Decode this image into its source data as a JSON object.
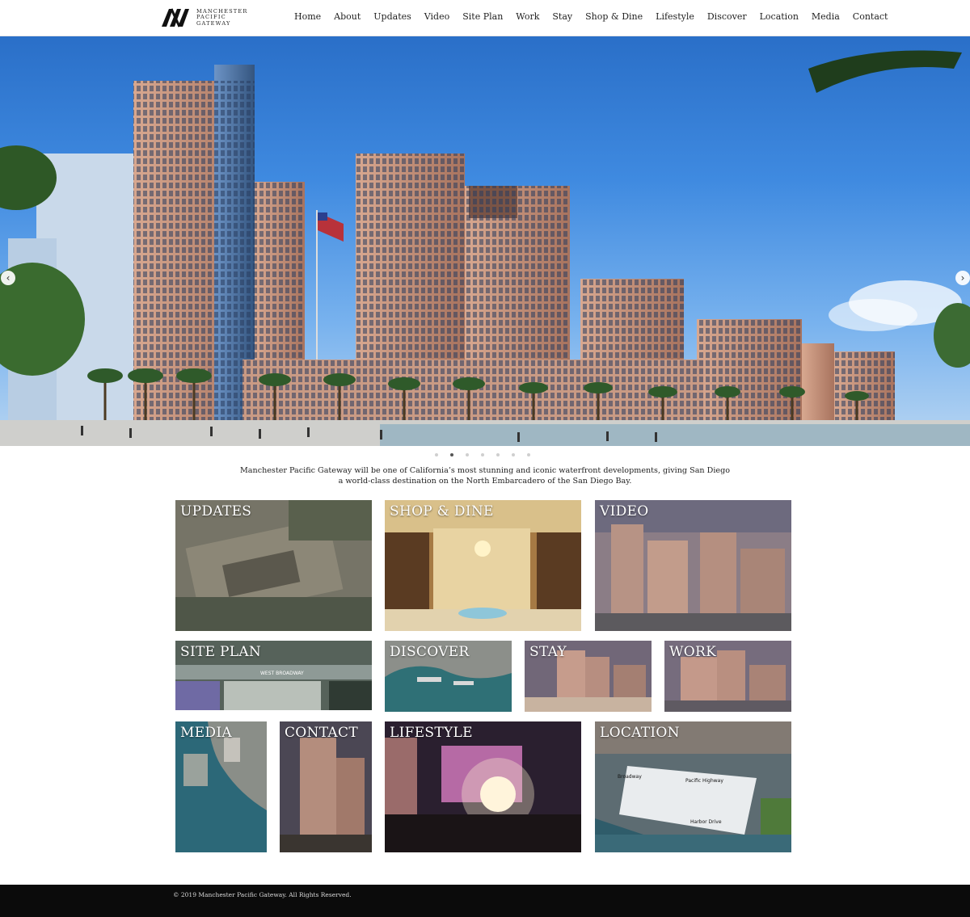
{
  "site": {
    "logo_lines": [
      "Manchester",
      "Pacific",
      "Gateway"
    ]
  },
  "nav": [
    "Home",
    "About",
    "Updates",
    "Video",
    "Site Plan",
    "Work",
    "Stay",
    "Shop & Dine",
    "Lifestyle",
    "Discover",
    "Location",
    "Media",
    "Contact"
  ],
  "hero": {
    "prev_icon": "chevron-left-icon",
    "next_icon": "chevron-right-icon",
    "prev_glyph": "‹",
    "next_glyph": "›",
    "slide_count": 7,
    "active_slide": 2
  },
  "intro": "Manchester Pacific Gateway will be one of California’s most stunning and iconic waterfront developments, giving San Diego a world-class destination on the North Embarcadero of the San Diego Bay.",
  "tiles": {
    "updates": "UPDATES",
    "shop_dine": "SHOP & DINE",
    "video": "VIDEO",
    "site_plan": "SITE PLAN",
    "discover": "DISCOVER",
    "stay": "STAY",
    "work": "WORK",
    "media": "MEDIA",
    "contact": "CONTACT",
    "lifestyle": "LIFESTYLE",
    "location": "LOCATION"
  },
  "map_labels": {
    "site_plan_street": "WEST BROADWAY",
    "location_street_1": "Broadway",
    "location_street_2": "Pacific Highway",
    "location_street_3": "Harbor Drive"
  },
  "footer": "© 2019 Manchester Pacific Gateway. All Rights Reserved.",
  "colors": {
    "sky": "#3f8ae0",
    "tower": "#c9957d",
    "glass": "#4e78a8",
    "water": "#2e6f7a",
    "footer": "#0b0b0b"
  }
}
